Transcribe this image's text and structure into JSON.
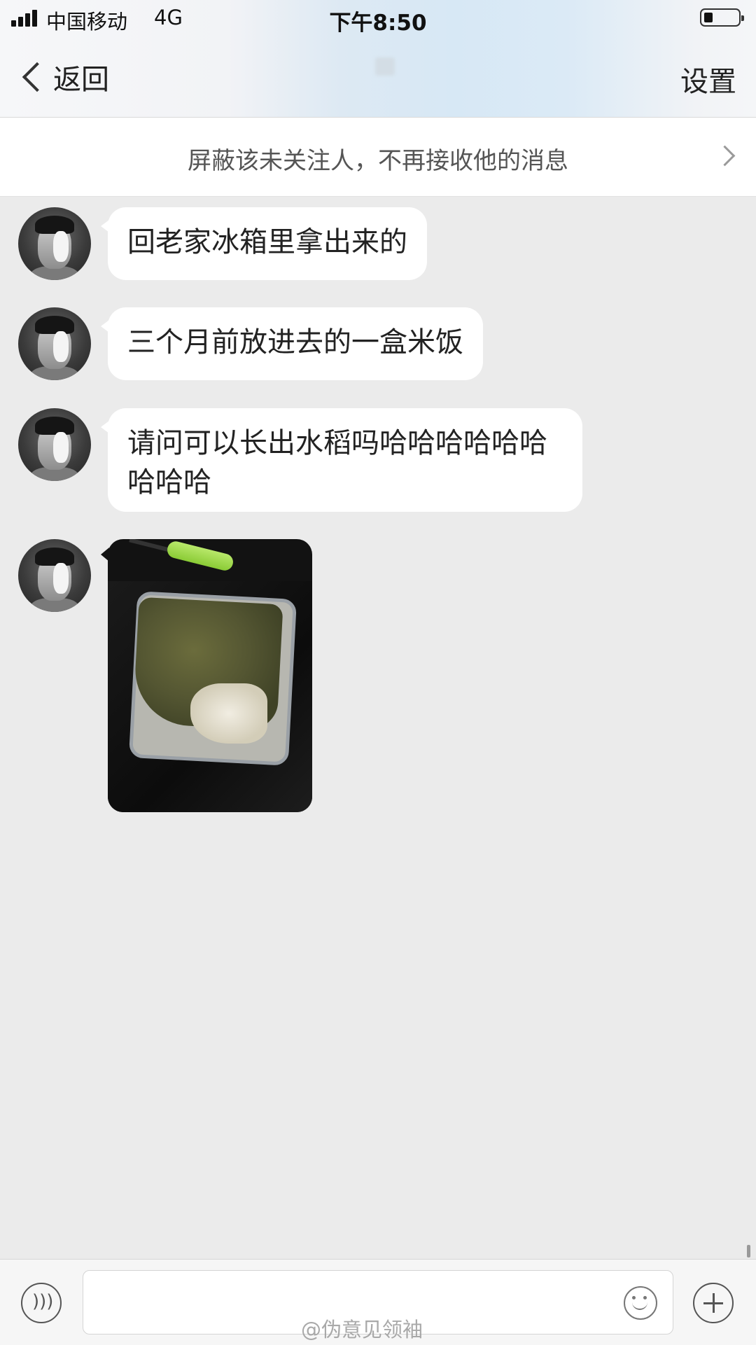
{
  "status_bar": {
    "carrier": "中国移动",
    "network": "4G",
    "time": "下午8:50"
  },
  "nav": {
    "back_label": "返回",
    "settings_label": "设置"
  },
  "block_banner": {
    "text": "屏蔽该未关注人，不再接收他的消息"
  },
  "messages": [
    {
      "type": "text",
      "text": "回老家冰箱里拿出来的"
    },
    {
      "type": "text",
      "text": "三个月前放进去的一盒米饭"
    },
    {
      "type": "text",
      "text": "请问可以长出水稻吗哈哈哈哈哈哈哈哈哈"
    },
    {
      "type": "image"
    }
  ],
  "watermark": "@伪意见领袖",
  "colors": {
    "background": "#ebebeb",
    "bubble": "#ffffff",
    "text": "#222222"
  }
}
